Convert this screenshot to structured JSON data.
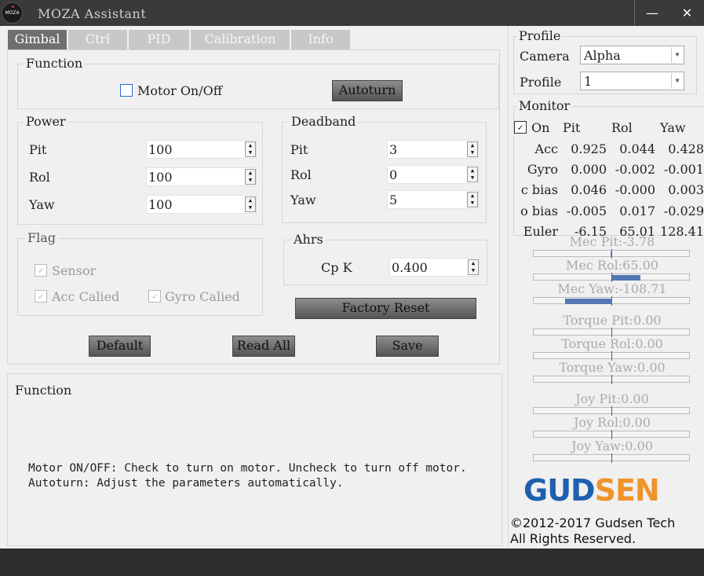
{
  "window": {
    "title": "MOZA Assistant",
    "logo_text": "MOZA",
    "minimize": "—",
    "close": "✕"
  },
  "tabs": [
    {
      "label": "Gimbal",
      "active": true
    },
    {
      "label": "Ctrl"
    },
    {
      "label": "PID"
    },
    {
      "label": "Calibration"
    },
    {
      "label": "Info"
    }
  ],
  "function_group": {
    "title": "Function",
    "motor_label": "Motor On/Off",
    "motor_checked": false,
    "autoturn_button": "Autoturn"
  },
  "power": {
    "title": "Power",
    "rows": [
      {
        "label": "Pit",
        "value": "100"
      },
      {
        "label": "Rol",
        "value": "100"
      },
      {
        "label": "Yaw",
        "value": "100"
      }
    ]
  },
  "deadband": {
    "title": "Deadband",
    "rows": [
      {
        "label": "Pit",
        "value": "3"
      },
      {
        "label": "Rol",
        "value": "0"
      },
      {
        "label": "Yaw",
        "value": "5"
      }
    ]
  },
  "flag": {
    "title": "Flag",
    "sensor": "Sensor",
    "acc_calied": "Acc Calied",
    "gyro_calied": "Gyro Calied"
  },
  "ahrs": {
    "title": "Ahrs",
    "cpk_label": "Cp K",
    "cpk_value": "0.400"
  },
  "buttons": {
    "factory_reset": "Factory Reset",
    "default": "Default",
    "read_all": "Read All",
    "save": "Save"
  },
  "help": {
    "title": "Function",
    "text": "Motor ON/OFF: Check to turn on motor. Uncheck to turn off motor.\nAutoturn: Adjust the parameters automatically."
  },
  "profile": {
    "title": "Profile",
    "camera_label": "Camera",
    "camera_value": "Alpha",
    "profile_label": "Profile",
    "profile_value": "1"
  },
  "monitor": {
    "title": "Monitor",
    "on_label": "On",
    "on_checked": true,
    "headers": [
      "Pit",
      "Rol",
      "Yaw"
    ],
    "rows": [
      {
        "label": "Acc",
        "pit": "0.925",
        "rol": "0.044",
        "yaw": "0.428"
      },
      {
        "label": "Gyro",
        "pit": "0.000",
        "rol": "-0.002",
        "yaw": "-0.001"
      },
      {
        "label": "c bias",
        "pit": "0.046",
        "rol": "-0.000",
        "yaw": "0.003"
      },
      {
        "label": "o bias",
        "pit": "-0.005",
        "rol": "0.017",
        "yaw": "-0.029"
      },
      {
        "label": "Euler",
        "pit": "-6.15",
        "rol": "65.01",
        "yaw": "128.41"
      }
    ]
  },
  "gauges": [
    {
      "label": "Mec Pit:-3.78",
      "value": -3.78
    },
    {
      "label": "Mec Rol:65.00",
      "value": 65.0
    },
    {
      "label": "Mec Yaw:-108.71",
      "value": -108.71
    },
    {
      "label": "Torque Pit:0.00",
      "value": 0
    },
    {
      "label": "Torque Rol:0.00",
      "value": 0
    },
    {
      "label": "Torque Yaw:0.00",
      "value": 0
    },
    {
      "label": "Joy Pit:0.00",
      "value": 0
    },
    {
      "label": "Joy Rol:0.00",
      "value": 0
    },
    {
      "label": "Joy Yaw:0.00",
      "value": 0
    }
  ],
  "brand": {
    "logo_part1": "GUD",
    "logo_part2": "SEN",
    "color1": "#1f5fb0",
    "color2": "#f0932b",
    "copyright": "©2012-2017 Gudsen Tech",
    "rights": "All Rights Reserved."
  }
}
